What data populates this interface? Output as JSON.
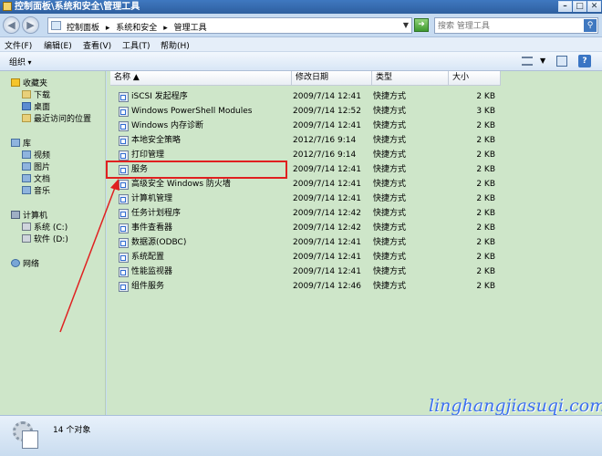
{
  "window": {
    "title": "控制面板\\系统和安全\\管理工具",
    "buttons": {
      "minimize": "–",
      "maximize": "□",
      "close": "✕"
    }
  },
  "address": {
    "crumbs": [
      "控制面板",
      "▸",
      "系统和安全",
      "▸",
      "管理工具"
    ],
    "search_placeholder": "搜索 管理工具"
  },
  "menu": [
    "文件(F)",
    "编辑(E)",
    "查看(V)",
    "工具(T)",
    "帮助(H)"
  ],
  "toolbar": {
    "organize": "组织"
  },
  "nav": {
    "favorites": "收藏夹",
    "downloads": "下载",
    "desktop": "桌面",
    "recent": "最近访问的位置",
    "libraries": "库",
    "videos": "视频",
    "pictures": "图片",
    "documents": "文档",
    "music": "音乐",
    "computer": "计算机",
    "drive_c": "系统 (C:)",
    "drive_d": "软件 (D:)",
    "network": "网络"
  },
  "columns": {
    "name": "名称 ▲",
    "date": "修改日期",
    "type": "类型",
    "size": "大小"
  },
  "files": [
    {
      "name": "iSCSI 发起程序",
      "date": "2009/7/14 12:41",
      "type": "快捷方式",
      "size": "2 KB"
    },
    {
      "name": "Windows PowerShell Modules",
      "date": "2009/7/14 12:52",
      "type": "快捷方式",
      "size": "3 KB"
    },
    {
      "name": "Windows 内存诊断",
      "date": "2009/7/14 12:41",
      "type": "快捷方式",
      "size": "2 KB"
    },
    {
      "name": "本地安全策略",
      "date": "2012/7/16 9:14",
      "type": "快捷方式",
      "size": "2 KB"
    },
    {
      "name": "打印管理",
      "date": "2012/7/16 9:14",
      "type": "快捷方式",
      "size": "2 KB"
    },
    {
      "name": "服务",
      "date": "2009/7/14 12:41",
      "type": "快捷方式",
      "size": "2 KB"
    },
    {
      "name": "高级安全 Windows 防火墙",
      "date": "2009/7/14 12:41",
      "type": "快捷方式",
      "size": "2 KB"
    },
    {
      "name": "计算机管理",
      "date": "2009/7/14 12:41",
      "type": "快捷方式",
      "size": "2 KB"
    },
    {
      "name": "任务计划程序",
      "date": "2009/7/14 12:42",
      "type": "快捷方式",
      "size": "2 KB"
    },
    {
      "name": "事件查看器",
      "date": "2009/7/14 12:42",
      "type": "快捷方式",
      "size": "2 KB"
    },
    {
      "name": "数据源(ODBC)",
      "date": "2009/7/14 12:41",
      "type": "快捷方式",
      "size": "2 KB"
    },
    {
      "name": "系统配置",
      "date": "2009/7/14 12:41",
      "type": "快捷方式",
      "size": "2 KB"
    },
    {
      "name": "性能监视器",
      "date": "2009/7/14 12:41",
      "type": "快捷方式",
      "size": "2 KB"
    },
    {
      "name": "组件服务",
      "date": "2009/7/14 12:46",
      "type": "快捷方式",
      "size": "2 KB"
    }
  ],
  "status": {
    "count": "14 个对象"
  },
  "watermark": "linghangjiasuqi.com",
  "colors": {
    "annotation": "#e02020",
    "pane_bg": "#cee6c9",
    "watermark": "#3b6ff0"
  }
}
